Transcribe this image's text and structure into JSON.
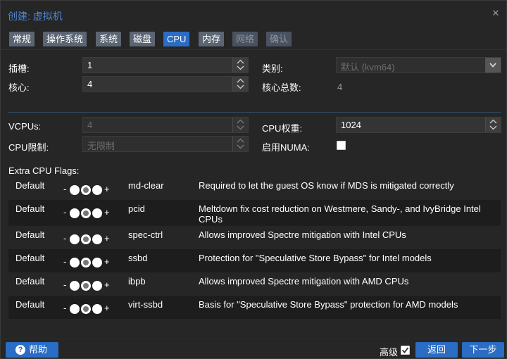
{
  "window": {
    "title": "创建: 虚拟机"
  },
  "tabs": [
    {
      "label": "常规",
      "state": "normal"
    },
    {
      "label": "操作系统",
      "state": "normal"
    },
    {
      "label": "系统",
      "state": "normal"
    },
    {
      "label": "磁盘",
      "state": "normal"
    },
    {
      "label": "CPU",
      "state": "active"
    },
    {
      "label": "内存",
      "state": "normal"
    },
    {
      "label": "网络",
      "state": "disabled"
    },
    {
      "label": "确认",
      "state": "disabled"
    }
  ],
  "form": {
    "sockets_label": "插槽:",
    "sockets_value": "1",
    "cores_label": "核心:",
    "cores_value": "4",
    "type_label": "类别:",
    "type_value": "默认 (kvm64)",
    "total_cores_label": "核心总数:",
    "total_cores_value": "4",
    "vcpus_label": "VCPUs:",
    "vcpus_value": "4",
    "cpu_limit_label": "CPU限制:",
    "cpu_limit_value": "无限制",
    "cpu_weight_label": "CPU权重:",
    "cpu_weight_value": "1024",
    "numa_label": "启用NUMA:",
    "numa_checked": false
  },
  "flags": {
    "title": "Extra CPU Flags:",
    "rows": [
      {
        "state": "Default",
        "name": "md-clear",
        "desc": "Required to let the guest OS know if MDS is mitigated correctly"
      },
      {
        "state": "Default",
        "name": "pcid",
        "desc": "Meltdown fix cost reduction on Westmere, Sandy-, and IvyBridge Intel CPUs"
      },
      {
        "state": "Default",
        "name": "spec-ctrl",
        "desc": "Allows improved Spectre mitigation with Intel CPUs"
      },
      {
        "state": "Default",
        "name": "ssbd",
        "desc": "Protection for \"Speculative Store Bypass\" for Intel models"
      },
      {
        "state": "Default",
        "name": "ibpb",
        "desc": "Allows improved Spectre mitigation with AMD CPUs"
      },
      {
        "state": "Default",
        "name": "virt-ssbd",
        "desc": "Basis for \"Speculative Store Bypass\" protection for AMD models"
      }
    ],
    "minus": "-",
    "plus": "+"
  },
  "footer": {
    "help_label": "帮助",
    "advanced_label": "高级",
    "advanced_checked": true,
    "back_label": "返回",
    "next_label": "下一步"
  },
  "icons": {
    "close": "close-icon",
    "help": "help-icon",
    "spinner": "spinner-icon",
    "dropdown": "chevron-down-icon"
  },
  "colors": {
    "accent": "#2b6cc4",
    "title": "#4e86d6",
    "background": "#262626"
  }
}
